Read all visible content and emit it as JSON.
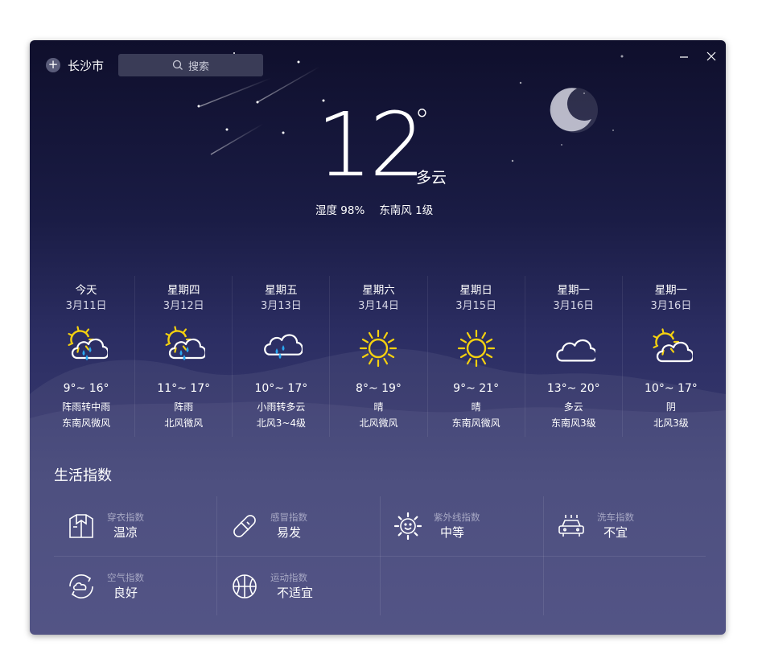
{
  "header": {
    "add_symbol": "+",
    "city": "长沙市",
    "search_placeholder": "搜索",
    "minimize_icon": "minimize-icon",
    "close_icon": "close-icon"
  },
  "current": {
    "temperature": "12",
    "degree_symbol": "°",
    "condition": "多云",
    "humidity": "湿度 98%",
    "wind": "东南风 1级"
  },
  "forecast": [
    {
      "day": "今天",
      "date": "3月11日",
      "icon": "sun-cloud-rain-icon",
      "range": "9°~ 16°",
      "desc": "阵雨转中雨",
      "wind": "东南风微风"
    },
    {
      "day": "星期四",
      "date": "3月12日",
      "icon": "sun-cloud-rain-icon",
      "range": "11°~ 17°",
      "desc": "阵雨",
      "wind": "北风微风"
    },
    {
      "day": "星期五",
      "date": "3月13日",
      "icon": "cloud-rain-icon",
      "range": "10°~ 17°",
      "desc": "小雨转多云",
      "wind": "北风3~4级"
    },
    {
      "day": "星期六",
      "date": "3月14日",
      "icon": "sun-icon",
      "range": "8°~ 19°",
      "desc": "晴",
      "wind": "北风微风"
    },
    {
      "day": "星期日",
      "date": "3月15日",
      "icon": "sun-icon",
      "range": "9°~ 21°",
      "desc": "晴",
      "wind": "东南风微风"
    },
    {
      "day": "星期一",
      "date": "3月16日",
      "icon": "cloud-icon",
      "range": "13°~ 20°",
      "desc": "多云",
      "wind": "东南风3级"
    },
    {
      "day": "星期一",
      "date": "3月16日",
      "icon": "sun-cloud-icon",
      "range": "10°~ 17°",
      "desc": "阴",
      "wind": "北风3级"
    }
  ],
  "life": {
    "title": "生活指数",
    "items": [
      {
        "label": "穿衣指数",
        "value": "温凉",
        "icon": "clothing-icon"
      },
      {
        "label": "感冒指数",
        "value": "易发",
        "icon": "pill-icon"
      },
      {
        "label": "紫外线指数",
        "value": "中等",
        "icon": "uv-sun-face-icon"
      },
      {
        "label": "洗车指数",
        "value": "不宜",
        "icon": "car-wash-icon"
      },
      {
        "label": "空气指数",
        "value": "良好",
        "icon": "air-cycle-icon"
      },
      {
        "label": "运动指数",
        "value": "不适宜",
        "icon": "basketball-icon"
      }
    ]
  },
  "colors": {
    "sun": "#f5d10f",
    "rain": "#29a8f2",
    "background_top": "#0f0f2c",
    "background_bottom": "#3f4078"
  }
}
